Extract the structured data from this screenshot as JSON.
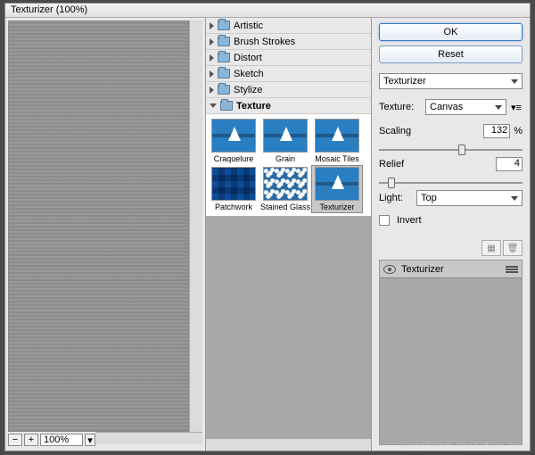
{
  "window": {
    "title": "Texturizer (100%)"
  },
  "preview": {
    "zoom": "100%"
  },
  "categories": [
    {
      "label": "Artistic",
      "open": false
    },
    {
      "label": "Brush Strokes",
      "open": false
    },
    {
      "label": "Distort",
      "open": false
    },
    {
      "label": "Sketch",
      "open": false
    },
    {
      "label": "Stylize",
      "open": false
    },
    {
      "label": "Texture",
      "open": true
    }
  ],
  "texture_thumbs": [
    {
      "label": "Craquelure"
    },
    {
      "label": "Grain"
    },
    {
      "label": "Mosaic Tiles"
    },
    {
      "label": "Patchwork"
    },
    {
      "label": "Stained Glass"
    },
    {
      "label": "Texturizer",
      "selected": true
    }
  ],
  "buttons": {
    "ok": "OK",
    "reset": "Reset"
  },
  "filter_select": "Texturizer",
  "settings": {
    "texture_label": "Texture:",
    "texture_value": "Canvas",
    "scaling_label": "Scaling",
    "scaling_value": "132",
    "scaling_unit": "%",
    "relief_label": "Relief",
    "relief_value": "4",
    "light_label": "Light:",
    "light_value": "Top",
    "invert_label": "Invert"
  },
  "layer": {
    "name": "Texturizer"
  },
  "watermark": "jiaocheng.chazidian.com"
}
